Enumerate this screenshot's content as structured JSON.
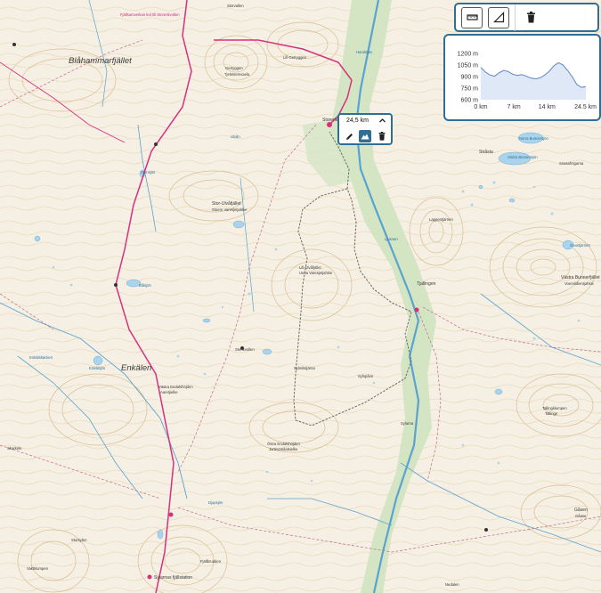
{
  "map": {
    "places": {
      "blahammar": "Blåhammarfjället",
      "enkalen": "Enkälen",
      "stor_ulvafjallet": "Stor-Ulvåfjället",
      "stoere": "Stoere Varesjetjahkie",
      "lill_ulvafjallet": "Lill-Ulvåfjället",
      "lill_ulvafjallet_sami": "Unna Varesjetjahkie",
      "storerikvollen": "Storerikvollen",
      "tjallingen": "Tjallingen",
      "vastra_bunnerfjallet": "Västra Bunnerfjället",
      "vastra_bunnerfjallet_sami": "Voerelidientjahkie",
      "gasen": "Gåsen",
      "gasen_sami": "Gåase",
      "tallingklumpen": "Tallingklumpen",
      "tallingklumpen_sami": "Tallinge",
      "sylarnas": "Sylarnas fjällstation",
      "lill_getryggen": "Lill-Getryggen",
      "getryggen": "Getryggen",
      "getryggen_sami": "Tjeletsemvaela",
      "stora": "Stråsta",
      "ostra_endalsh": "Östra Endalshöjden",
      "ostra_endalsh_sami": "Jurtevandalsielke",
      "vastra_endalsh": "Västra Endalshöjden",
      "vastra_endalsh_sami": "Aaretjielke",
      "sylmilet": "Sylmilstjärna",
      "lill_sylen": "Sylspåen",
      "stensvollen": "Stensvollen",
      "blaskjorten": "Blåsjön",
      "norra_bunner": "Norra Bunnersjön",
      "sodra_bunner": "Södra Bunnersjön",
      "lappentjarnen": "Lappentjärnen",
      "gaustjarn": "Gaustjärnen",
      "endal": "Enkälsjön",
      "storsylen": "Storsylen",
      "vaktkumpen": "Vaktklumpen",
      "fjallbrudden": "Fjällbrudden",
      "enkalsbacken": "Enkälsbäcken",
      "snasahogarna": "Snasahögarna",
      "djupsjon": "Djupsjön",
      "handolan": "Handölan",
      "stensjon": "Stensjön",
      "ljusnan": "Ljusnan",
      "skarkeln": "Skarkeln",
      "ulvon": "Ulvån",
      "storvallen": "Storvallen",
      "nedalen": "Nedalen",
      "sylarna": "Sylarna"
    },
    "trail_note": "Fjällsamverkan led till Storerikvollen"
  },
  "toolbar": {
    "ruler_icon": "ruler-icon",
    "profile_icon": "elevation-profile-icon",
    "trash_icon": "trash-icon"
  },
  "elevation": {
    "y_ticks": [
      "1200 m",
      "1050 m",
      "900 m",
      "750 m",
      "600 m"
    ],
    "x_ticks": [
      "0 km",
      "7 km",
      "14 km",
      "24.5 km"
    ],
    "y_range": [
      600,
      1200
    ],
    "x_range_km": [
      0,
      24.5
    ],
    "profile_m": [
      1020,
      960,
      920,
      905,
      950,
      980,
      965,
      930,
      915,
      925,
      905,
      880,
      870,
      885,
      920,
      970,
      1040,
      1080,
      1050,
      980,
      900,
      800,
      760,
      770
    ],
    "line_color": "#6a8fc9"
  },
  "route": {
    "distance": "24,5 km",
    "edit_icon": "pencil-icon",
    "elevation_icon": "mountain-icon",
    "delete_icon": "trash-icon",
    "accent": "#2f6f95"
  }
}
